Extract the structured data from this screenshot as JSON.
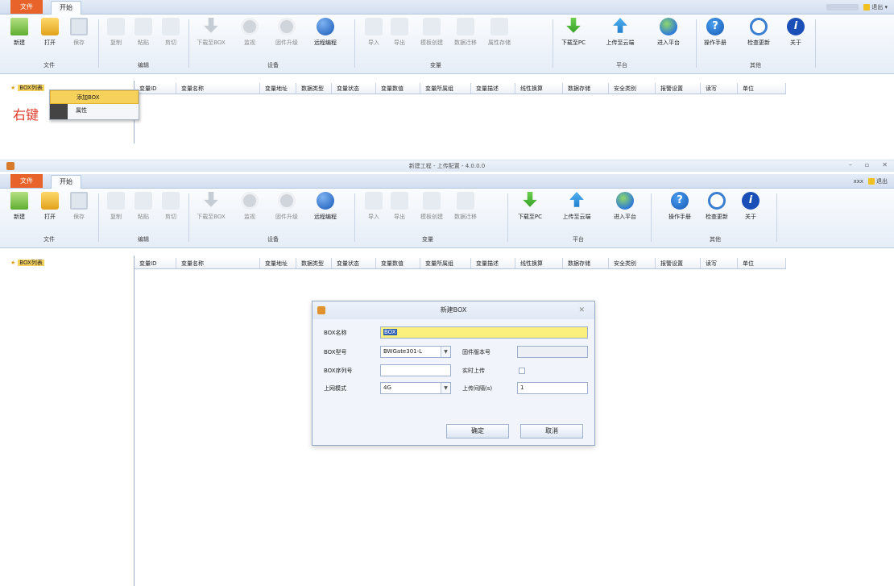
{
  "top_panel": {
    "tabs": {
      "file": "文件",
      "home": "开始"
    },
    "user_logout": "退出",
    "ribbon": {
      "buttons": {
        "new": "新建",
        "open": "打开",
        "save": "保存",
        "copy": "复制",
        "paste": "粘贴",
        "cut": "剪切",
        "download_box": "下载至BOX",
        "monitor": "监视",
        "firmware": "固件升级",
        "remote": "远程编程",
        "import": "导入",
        "export": "导出",
        "template": "模板创建",
        "data_transfer": "数据迁移",
        "attr_store": "属性存储",
        "download_pc": "下载至PC",
        "upload_cloud": "上传至云端",
        "enter_platform": "进入平台",
        "manual": "操作手册",
        "check_update": "检查更新",
        "about": "关于"
      },
      "groups": {
        "file": "文件",
        "edit": "编辑",
        "device": "设备",
        "variable": "变量",
        "platform": "平台",
        "other": "其他"
      }
    },
    "tree_root": "BOX列表",
    "columns": [
      "变量ID",
      "变量名称",
      "变量地址",
      "数据类型",
      "变量状态",
      "变量数值",
      "变量所属组",
      "变量描述",
      "线性换算",
      "数据存储",
      "安全类别",
      "报警设置",
      "读写",
      "单位"
    ],
    "context_menu": {
      "items": [
        "添加BOX",
        "属性"
      ]
    },
    "annotation": "右键"
  },
  "bottom_panel": {
    "window_title": "新建工程 - 上传配置 - 4.0.0.0",
    "tabs": {
      "file": "文件",
      "home": "开始"
    },
    "user_logout": "退出",
    "user_name": "xxx",
    "tree_root": "BOX列表",
    "dialog": {
      "title": "新建BOX",
      "fields": {
        "box_name_label": "BOX名称",
        "box_name_value": "BOX",
        "box_model_label": "BOX型号",
        "box_model_value": "BWGate301-L",
        "firmware_label": "固件版本号",
        "firmware_value": "",
        "box_serial_label": "BOX序列号",
        "box_serial_value": "",
        "realtime_label": "实时上传",
        "uplink_label": "上网模式",
        "uplink_value": "4G",
        "interval_label": "上传间隔(s)",
        "interval_value": "1"
      },
      "ok": "确定",
      "cancel": "取消"
    }
  }
}
